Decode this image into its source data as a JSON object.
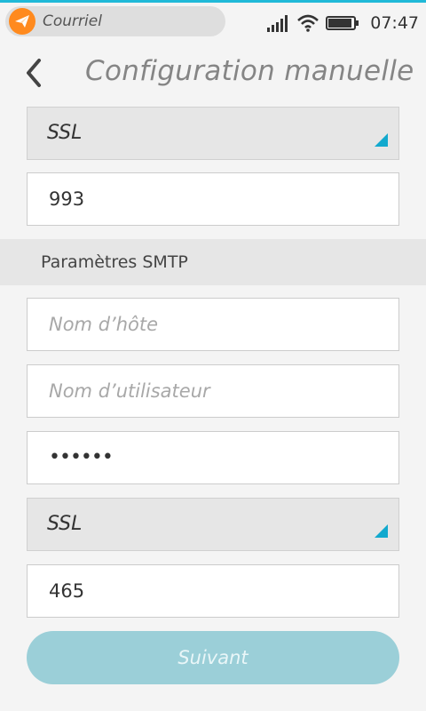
{
  "status_bar": {
    "app_name": "Courriel",
    "time": "07:47",
    "app_icon": "paper-plane-icon",
    "accent_color": "#20b9d8"
  },
  "header": {
    "title": "Configuration manuelle",
    "back_icon": "chevron-left-icon"
  },
  "imap": {
    "security": "SSL",
    "port": "993"
  },
  "smtp": {
    "section_title": "Paramètres SMTP",
    "hostname_placeholder": "Nom d’hôte",
    "username_placeholder": "Nom d’utilisateur",
    "password_value": "••••••",
    "security": "SSL",
    "port": "465"
  },
  "footer": {
    "next_label": "Suivant",
    "next_enabled": false
  }
}
